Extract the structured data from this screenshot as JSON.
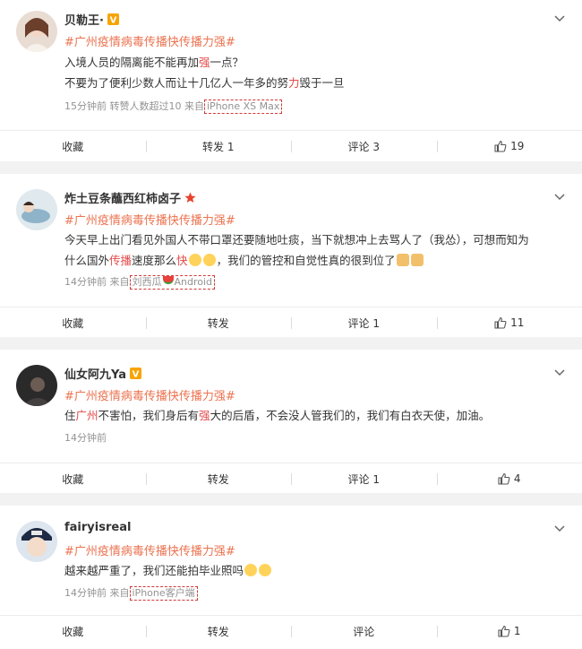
{
  "comments": [
    {
      "user": "贝勒王·",
      "badge": "V",
      "topic": "#广州疫情病毒传播快传播力强#",
      "lines": [
        "入境人员的隔离能不能再加强一点？",
        "不要为了便利少数人而让十几亿人一年多的努力毁于一旦"
      ],
      "time": "15分钟前",
      "extra": "转赞人数超过10",
      "from_label": "来自",
      "source": "iPhone XS Max",
      "actions": {
        "collect": "收藏",
        "repost": "转发 1",
        "comment": "评论 3",
        "like": "19"
      }
    },
    {
      "user": "炸土豆条蘸西红柿卤子",
      "badge": "★",
      "topic": "#广州疫情病毒传播快传播力强#",
      "line1": "今天早上出门看见外国人不带口罩还要随地吐痰，当下就想冲上去骂人了（我怂），可想而知为",
      "line2a": "什么国外",
      "line2b": "传播",
      "line2c": "速度那么",
      "line2d": "快",
      "line2e": "，我们的管控和自觉性真的很到位了",
      "time": "14分钟前",
      "from_label": "来自",
      "source_a": "刘西瓜",
      "source_b": "Android",
      "actions": {
        "collect": "收藏",
        "repost": "转发",
        "comment": "评论 1",
        "like": "11"
      }
    },
    {
      "user": "仙女阿九Ya",
      "badge": "V",
      "topic": "#广州疫情病毒传播快传播力强#",
      "seg1": "住",
      "seg2": "广州",
      "seg3": "不害怕，我们身后有",
      "seg4": "强",
      "seg5": "大的后盾，不会没人管我们的，我们有白衣天使，加油。",
      "time": "14分钟前",
      "actions": {
        "collect": "收藏",
        "repost": "转发",
        "comment": "评论 1",
        "like": "4"
      }
    },
    {
      "user": "fairyisreal",
      "topic": "#广州疫情病毒传播快传播力强#",
      "line": "越来越严重了，我们还能拍毕业照吗",
      "time": "14分钟前",
      "from_label": "来自",
      "source": "iPhone客户端",
      "actions": {
        "collect": "收藏",
        "repost": "转发",
        "comment": "评论",
        "like": "1"
      }
    }
  ],
  "colors": {
    "topic": "#eb7350",
    "highlight": "#e34a4a",
    "meta": "#939393",
    "vip": "#f7a400",
    "star": "#e8412c"
  }
}
